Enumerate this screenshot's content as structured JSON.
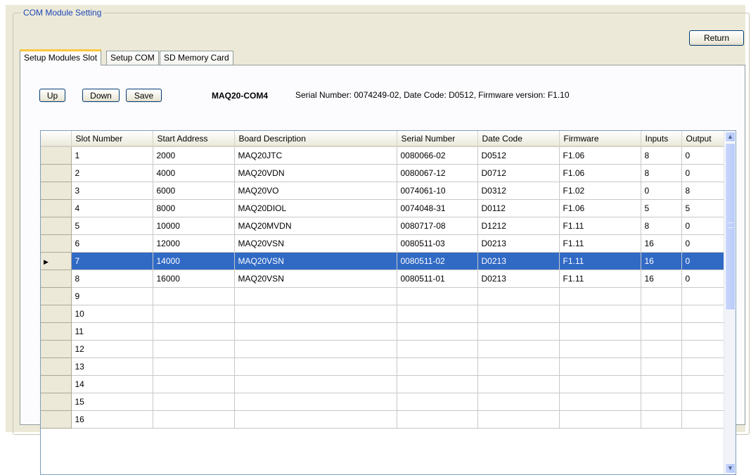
{
  "window": {
    "group_title": "COM Module Setting",
    "return_label": "Return"
  },
  "tabs": [
    {
      "label": "Setup Modules Slot",
      "active": true
    },
    {
      "label": "Setup COM",
      "active": false
    },
    {
      "label": "SD Memory Card",
      "active": false
    }
  ],
  "toolbar": {
    "up_label": "Up",
    "down_label": "Down",
    "save_label": "Save"
  },
  "module": {
    "name": "MAQ20-COM4",
    "info": "Serial Number: 0074249-02,   Date Code: D0512,  Firmware version: F1.10"
  },
  "grid": {
    "columns": [
      "Slot Number",
      "Start Address",
      "Board Description",
      "Serial Number",
      "Date Code",
      "Firmware",
      "Inputs",
      "Output"
    ],
    "selected_row": 6,
    "rows": [
      [
        "1",
        "2000",
        "MAQ20JTC",
        "0080066-02",
        "D0512",
        "F1.06",
        "8",
        "0"
      ],
      [
        "2",
        "4000",
        "MAQ20VDN",
        "0080067-12",
        "D0712",
        "F1.06",
        "8",
        "0"
      ],
      [
        "3",
        "6000",
        "MAQ20VO",
        "0074061-10",
        "D0312",
        "F1.02",
        "0",
        "8"
      ],
      [
        "4",
        "8000",
        "MAQ20DIOL",
        "0074048-31",
        "D0112",
        "F1.06",
        "5",
        "5"
      ],
      [
        "5",
        "10000",
        "MAQ20MVDN",
        "0080717-08",
        "D1212",
        "F1.11",
        "8",
        "0"
      ],
      [
        "6",
        "12000",
        "MAQ20VSN",
        "0080511-03",
        "D0213",
        "F1.11",
        "16",
        "0"
      ],
      [
        "7",
        "14000",
        "MAQ20VSN",
        "0080511-02",
        "D0213",
        "F1.11",
        "16",
        "0"
      ],
      [
        "8",
        "16000",
        "MAQ20VSN",
        "0080511-01",
        "D0213",
        "F1.11",
        "16",
        "0"
      ],
      [
        "9",
        "",
        "",
        "",
        "",
        "",
        "",
        ""
      ],
      [
        "10",
        "",
        "",
        "",
        "",
        "",
        "",
        ""
      ],
      [
        "11",
        "",
        "",
        "",
        "",
        "",
        "",
        ""
      ],
      [
        "12",
        "",
        "",
        "",
        "",
        "",
        "",
        ""
      ],
      [
        "13",
        "",
        "",
        "",
        "",
        "",
        "",
        ""
      ],
      [
        "14",
        "",
        "",
        "",
        "",
        "",
        "",
        ""
      ],
      [
        "15",
        "",
        "",
        "",
        "",
        "",
        "",
        ""
      ],
      [
        "16",
        "",
        "",
        "",
        "",
        "",
        "",
        ""
      ]
    ]
  },
  "icons": {
    "row_indicator": "row-pointer-icon",
    "scroll_up": "chevron-up-icon",
    "scroll_down": "chevron-down-icon"
  }
}
